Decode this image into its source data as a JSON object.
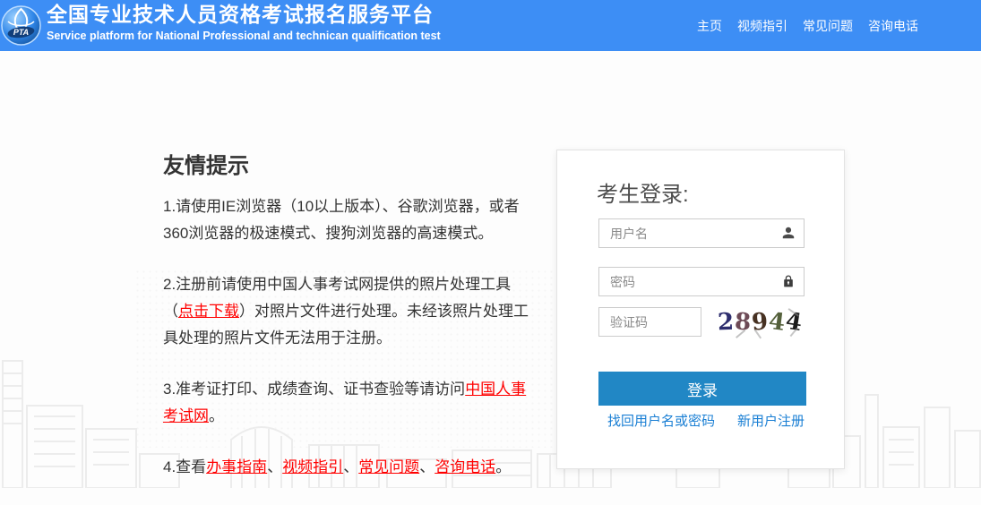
{
  "header": {
    "bg_color": "#3d8ef5",
    "logo_text": "PTA",
    "title": "全国专业技术人员资格考试报名服务平台",
    "subtitle": "Service platform for National Professional and technican qualification test",
    "nav": [
      {
        "label": "主页"
      },
      {
        "label": "视频指引"
      },
      {
        "label": "常见问题"
      },
      {
        "label": "咨询电话"
      }
    ]
  },
  "tips": {
    "heading": "友情提示",
    "link_color": "#ff0000",
    "items": [
      {
        "segments": [
          {
            "text": "1.请使用IE浏览器（10以上版本）、谷歌浏览器，或者360浏览器的极速模式、搜狗浏览器的高速模式。",
            "link": false
          }
        ]
      },
      {
        "segments": [
          {
            "text": "2.注册前请使用中国人事考试网提供的照片处理工具（",
            "link": false
          },
          {
            "text": "点击下载",
            "link": true
          },
          {
            "text": "）对照片文件进行处理。未经该照片处理工具处理的照片文件无法用于注册。",
            "link": false
          }
        ]
      },
      {
        "segments": [
          {
            "text": "3.准考证打印、成绩查询、证书查验等请访问",
            "link": false
          },
          {
            "text": "中国人事考试网",
            "link": true
          },
          {
            "text": "。",
            "link": false
          }
        ]
      },
      {
        "segments": [
          {
            "text": "4.查看",
            "link": false
          },
          {
            "text": "办事指南",
            "link": true
          },
          {
            "text": "、",
            "link": false
          },
          {
            "text": "视频指引",
            "link": true
          },
          {
            "text": "、",
            "link": false
          },
          {
            "text": "常见问题",
            "link": true
          },
          {
            "text": "、",
            "link": false
          },
          {
            "text": "咨询电话",
            "link": true
          },
          {
            "text": "。",
            "link": false
          }
        ]
      }
    ]
  },
  "login": {
    "heading": "考生登录:",
    "username_placeholder": "用户名",
    "password_placeholder": "密码",
    "captcha_placeholder": "验证码",
    "captcha": {
      "value": "28944",
      "digits": [
        {
          "char": "2",
          "color": "#2e2e6e"
        },
        {
          "char": "8",
          "color": "#6d4a56"
        },
        {
          "char": "9",
          "color": "#473122"
        },
        {
          "char": "4",
          "color": "#55613c"
        },
        {
          "char": "4",
          "color": "#1c1c1c"
        }
      ]
    },
    "submit_label": "登录",
    "button_color": "#2187c5",
    "link_color": "#1a7fd4",
    "links": [
      {
        "label": "找回用户名或密码"
      },
      {
        "label": "新用户注册"
      }
    ]
  }
}
